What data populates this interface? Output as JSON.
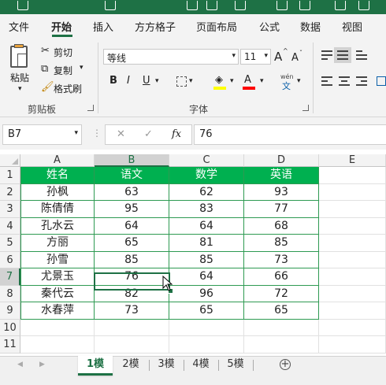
{
  "menu": {
    "tabs": [
      "文件",
      "开始",
      "插入",
      "方方格子",
      "页面布局",
      "公式",
      "数据",
      "视图"
    ],
    "active_tab": "开始"
  },
  "ribbon": {
    "clipboard": {
      "paste_label": "粘贴",
      "cut_label": "剪切",
      "copy_label": "复制",
      "format_painter_label": "格式刷",
      "group_label": "剪贴板"
    },
    "font": {
      "font_name": "等线",
      "font_size": "11",
      "grow_label": "A",
      "shrink_label": "A",
      "bold": "B",
      "italic": "I",
      "underline": "U",
      "font_color_label": "A",
      "phonetic_top": "wén",
      "phonetic_bottom": "文",
      "group_label": "字体",
      "highlight_color": "#ffff00",
      "font_color": "#ff0000"
    }
  },
  "formula_bar": {
    "name_box": "B7",
    "cancel": "✕",
    "enter": "✓",
    "fx": "fx",
    "value": "76"
  },
  "grid": {
    "columns": [
      "A",
      "B",
      "C",
      "D",
      "E"
    ],
    "rows": [
      "1",
      "2",
      "3",
      "4",
      "5",
      "6",
      "7",
      "8",
      "9",
      "10",
      "11"
    ],
    "selected_column": "B",
    "selected_row": "7",
    "header": [
      "姓名",
      "语文",
      "数学",
      "英语"
    ],
    "data": [
      [
        "孙枫",
        "63",
        "62",
        "93"
      ],
      [
        "陈倩倩",
        "95",
        "83",
        "77"
      ],
      [
        "孔水云",
        "64",
        "64",
        "68"
      ],
      [
        "方丽",
        "65",
        "81",
        "85"
      ],
      [
        "孙雪",
        "85",
        "85",
        "73"
      ],
      [
        "尤景玉",
        "76",
        "64",
        "66"
      ],
      [
        "秦代云",
        "82",
        "96",
        "72"
      ],
      [
        "水春萍",
        "73",
        "65",
        "65"
      ]
    ],
    "header_fill": "#00b050",
    "border_color": "#2e9a52"
  },
  "sheets": {
    "tabs": [
      "1模",
      "2模",
      "3模",
      "4模",
      "5模"
    ],
    "active": "1模",
    "add_label": "+",
    "prev": "◀",
    "next": "▶"
  }
}
